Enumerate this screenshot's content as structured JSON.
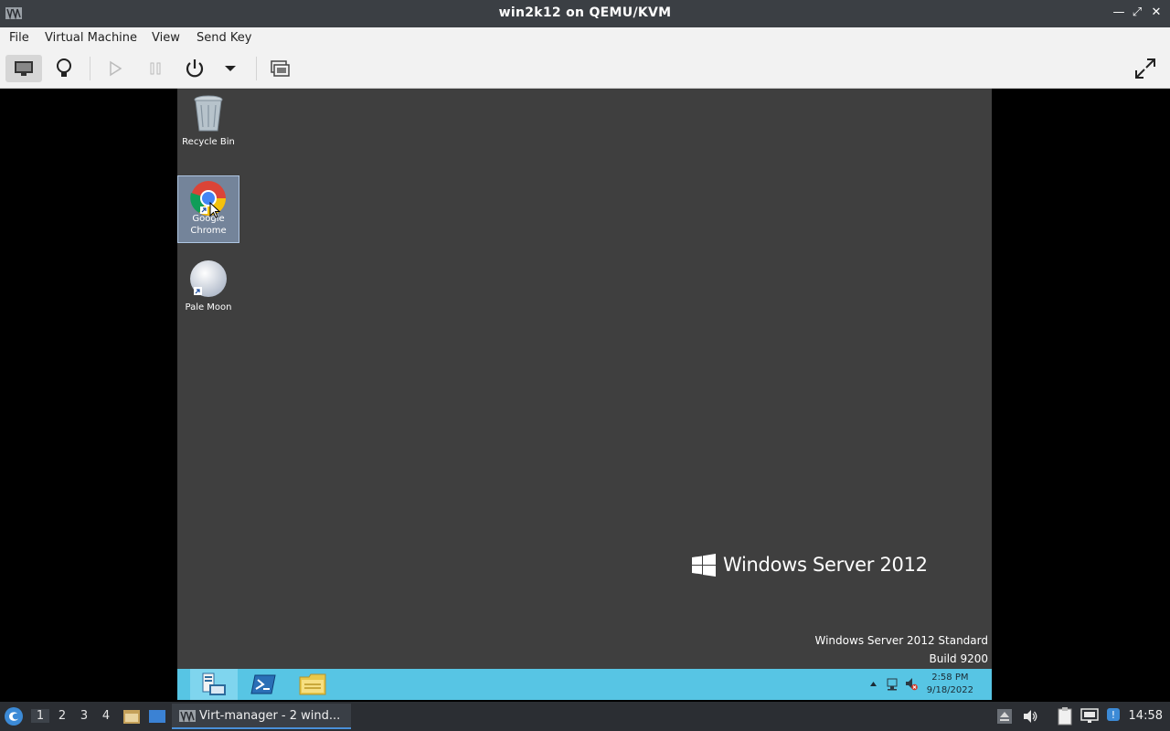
{
  "window": {
    "title": "win2k12 on QEMU/KVM"
  },
  "menu": {
    "items": [
      "File",
      "Virtual Machine",
      "View",
      "Send Key"
    ]
  },
  "toolbar": {
    "buttons": [
      "console-view",
      "details-view",
      "run",
      "pause",
      "shutdown",
      "shutdown-menu",
      "snapshots",
      "fullscreen"
    ]
  },
  "desktop": {
    "icons": [
      {
        "label": "Recycle Bin",
        "icon": "recycle-bin-icon"
      },
      {
        "label": "Google\nChrome",
        "icon": "chrome-icon",
        "selected": true
      },
      {
        "label": "Pale Moon",
        "icon": "pale-moon-icon"
      }
    ],
    "logo_text": "Windows Server 2012",
    "watermark_line1": "Windows Server 2012 Standard",
    "watermark_line2": "Build 9200"
  },
  "vm_taskbar": {
    "items": [
      "server-manager-icon",
      "powershell-icon",
      "file-explorer-icon"
    ],
    "clock_time": "2:58 PM",
    "clock_date": "9/18/2022"
  },
  "host_panel": {
    "workspaces": [
      "1",
      "2",
      "3",
      "4"
    ],
    "active_workspace": "1",
    "task_label": "Virt-manager - 2 wind...",
    "time": "14:58"
  },
  "colors": {
    "titlebar": "#3b3f44",
    "vm_desktop": "#3f3f3f",
    "vm_taskbar": "#57c5e4",
    "panel": "#2b2e33"
  }
}
